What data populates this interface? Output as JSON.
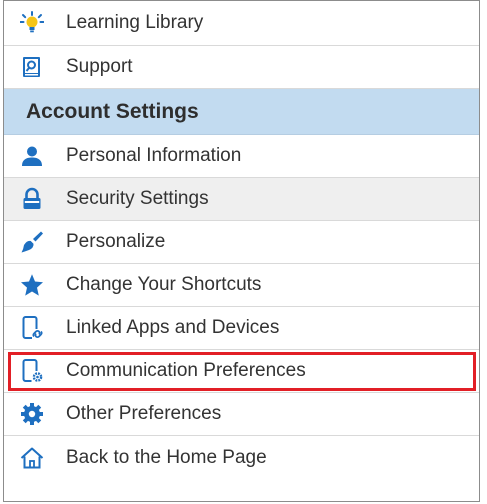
{
  "menu": {
    "items": [
      {
        "label": "Learning Library",
        "icon": "lightbulb-icon"
      },
      {
        "label": "Support",
        "icon": "support-book-icon"
      },
      {
        "label": "Account Settings",
        "type": "section-header"
      },
      {
        "label": "Personal Information",
        "icon": "person-icon"
      },
      {
        "label": "Security Settings",
        "icon": "lock-icon",
        "state": "hover"
      },
      {
        "label": "Personalize",
        "icon": "paintbrush-icon"
      },
      {
        "label": "Change Your Shortcuts",
        "icon": "star-icon"
      },
      {
        "label": "Linked Apps and Devices",
        "icon": "linked-device-icon"
      },
      {
        "label": "Communication Preferences",
        "icon": "device-gear-icon",
        "state": "outlined"
      },
      {
        "label": "Other Preferences",
        "icon": "gear-icon"
      },
      {
        "label": "Back to the Home Page",
        "icon": "home-icon"
      }
    ]
  },
  "colors": {
    "icon_blue": "#1e6fc0",
    "header_bg": "#c2dbf0",
    "highlight_bg": "#efefef",
    "outline_red": "#e21f26",
    "text": "#333333"
  }
}
